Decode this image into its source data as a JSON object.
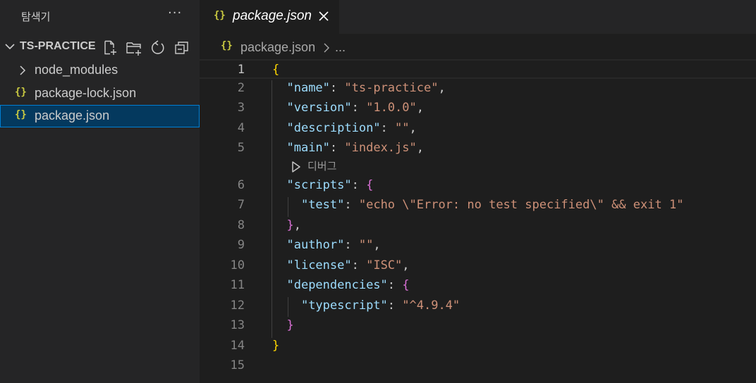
{
  "sidebar": {
    "title": "탐색기",
    "more": "···",
    "section_label": "TS-PRACTICE",
    "items": [
      {
        "label": "node_modules"
      },
      {
        "label": "package-lock.json",
        "icon": "{}"
      },
      {
        "label": "package.json",
        "icon": "{}"
      }
    ]
  },
  "editor": {
    "tab": {
      "label": "package.json",
      "icon": "{}"
    },
    "breadcrumb": {
      "icon": "{}",
      "file": "package.json",
      "more": "..."
    },
    "codelens": "디버그",
    "line_numbers": [
      "1",
      "2",
      "3",
      "4",
      "5",
      "6",
      "7",
      "8",
      "9",
      "10",
      "11",
      "12",
      "13",
      "14",
      "15"
    ],
    "lines": [
      {
        "open": "{"
      },
      {
        "key": "\"name\"",
        "value": "\"ts-practice\"",
        "tail": ","
      },
      {
        "key": "\"version\"",
        "value": "\"1.0.0\"",
        "tail": ","
      },
      {
        "key": "\"description\"",
        "value": "\"\"",
        "tail": ","
      },
      {
        "key": "\"main\"",
        "value": "\"index.js\"",
        "tail": ","
      },
      {
        "key": "\"scripts\"",
        "open": "{"
      },
      {
        "key": "\"test\"",
        "value": "\"echo \\\"Error: no test specified\\\" && exit 1\""
      },
      {
        "close": "}",
        "tail": ","
      },
      {
        "key": "\"author\"",
        "value": "\"\"",
        "tail": ","
      },
      {
        "key": "\"license\"",
        "value": "\"ISC\"",
        "tail": ","
      },
      {
        "key": "\"dependencies\"",
        "open": "{"
      },
      {
        "key": "\"typescript\"",
        "value": "\"^4.9.4\""
      },
      {
        "close": "}"
      },
      {
        "close": "}"
      }
    ]
  },
  "colors": {
    "sidebar_bg": "#252526",
    "editor_bg": "#1e1e1e",
    "selection_bg": "#04395e",
    "selection_border": "#007fd4",
    "json_key": "#9cdcfe",
    "json_string": "#ce9178",
    "bracket_level1": "#ffd700",
    "bracket_level2": "#da70d6",
    "json_icon": "#cbcb41"
  }
}
